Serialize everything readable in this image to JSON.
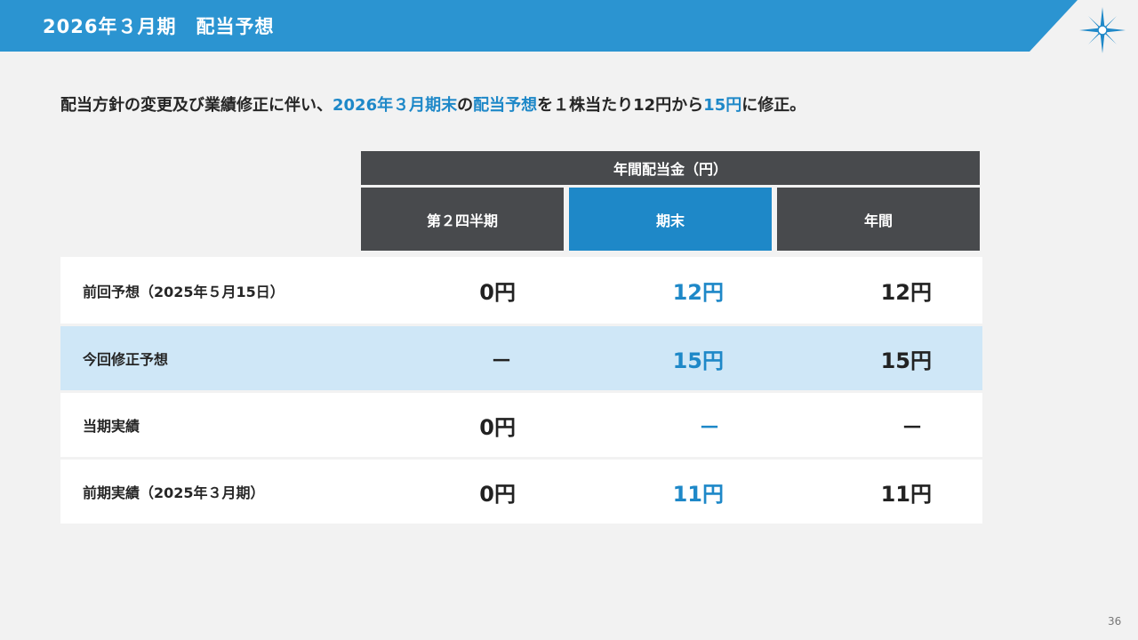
{
  "header": {
    "title": "2026年３月期　配当予想"
  },
  "lead": {
    "part1": "配当方針の変更及び業績修正に伴い、",
    "hl1": "2026年３月期末",
    "part2": "の",
    "hl2": "配当予想",
    "part3": "を１株当たり12円から",
    "hl3": "15円",
    "part4": "に修正。"
  },
  "table": {
    "group_header": "年間配当金（円）",
    "columns": [
      "第２四半期",
      "期末",
      "年間"
    ],
    "rows": [
      {
        "label": "前回予想（2025年５月15日）",
        "values": [
          "0円",
          "12円",
          "12円"
        ]
      },
      {
        "label": "今回修正予想",
        "values": [
          "－",
          "15円",
          "15円"
        ]
      },
      {
        "label": "当期実績",
        "values": [
          "0円",
          "－",
          "－"
        ]
      },
      {
        "label": "前期実績（2025年３月期）",
        "values": [
          "0円",
          "11円",
          "11円"
        ]
      }
    ]
  },
  "colors": {
    "header_blue": "#2b94d1",
    "accent_blue": "#1e88c8",
    "dark_header": "#484a4d",
    "highlight_row": "#cfe7f7"
  },
  "logo": {
    "icon": "compass-star-icon"
  },
  "footer": {
    "page_number": "36"
  }
}
